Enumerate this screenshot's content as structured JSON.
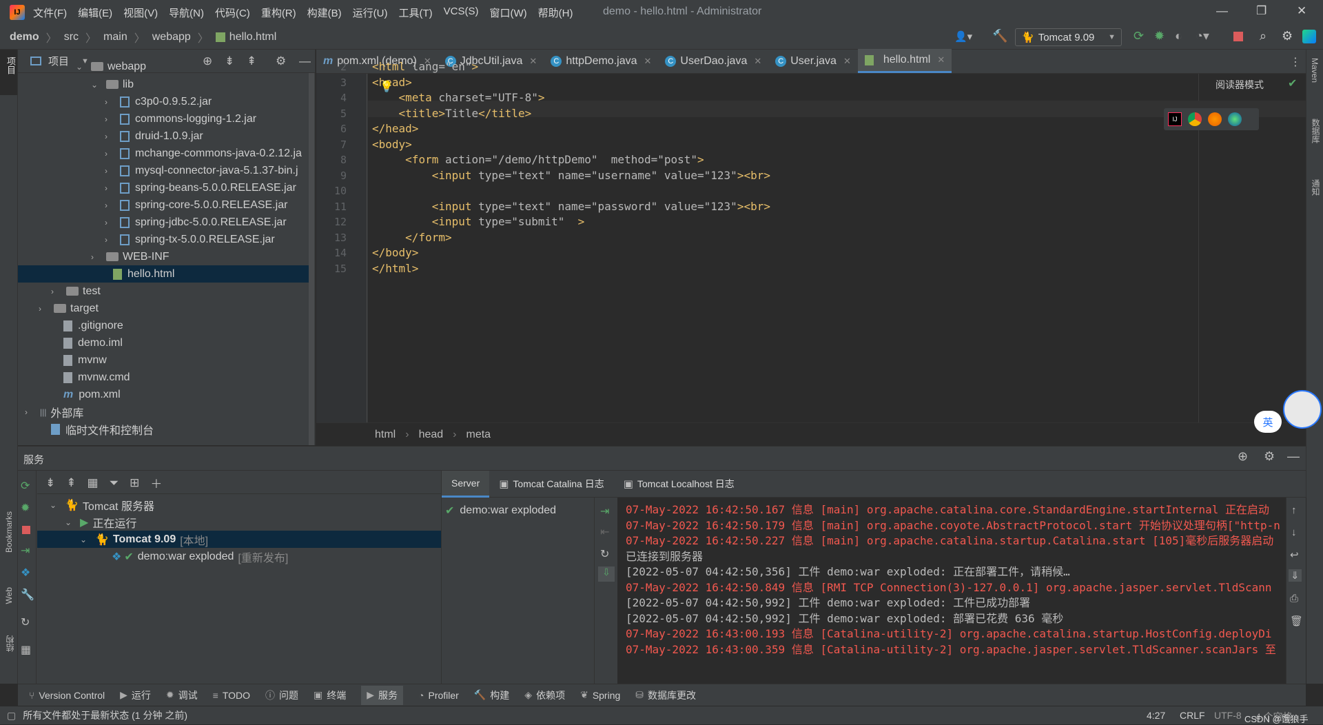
{
  "titlebar": {
    "menu": [
      "文件(F)",
      "编辑(E)",
      "视图(V)",
      "导航(N)",
      "代码(C)",
      "重构(R)",
      "构建(B)",
      "运行(U)",
      "工具(T)",
      "VCS(S)",
      "窗口(W)",
      "帮助(H)"
    ],
    "window_title": "demo - hello.html - Administrator"
  },
  "navbar": {
    "crumbs": [
      "demo",
      "src",
      "main",
      "webapp",
      "hello.html"
    ],
    "run_config": "Tomcat 9.09"
  },
  "project": {
    "title": "项目",
    "tree": [
      {
        "label": "webapp",
        "type": "folder"
      },
      {
        "label": "lib",
        "type": "folder"
      },
      {
        "label": "c3p0-0.9.5.2.jar",
        "type": "jar"
      },
      {
        "label": "commons-logging-1.2.jar",
        "type": "jar"
      },
      {
        "label": "druid-1.0.9.jar",
        "type": "jar"
      },
      {
        "label": "mchange-commons-java-0.2.12.ja",
        "type": "jar"
      },
      {
        "label": "mysql-connector-java-5.1.37-bin.j",
        "type": "jar"
      },
      {
        "label": "spring-beans-5.0.0.RELEASE.jar",
        "type": "jar"
      },
      {
        "label": "spring-core-5.0.0.RELEASE.jar",
        "type": "jar"
      },
      {
        "label": "spring-jdbc-5.0.0.RELEASE.jar",
        "type": "jar"
      },
      {
        "label": "spring-tx-5.0.0.RELEASE.jar",
        "type": "jar"
      },
      {
        "label": "WEB-INF",
        "type": "folder"
      },
      {
        "label": "hello.html",
        "type": "html"
      },
      {
        "label": "test",
        "type": "folder"
      },
      {
        "label": "target",
        "type": "folder"
      },
      {
        "label": ".gitignore",
        "type": "file"
      },
      {
        "label": "demo.iml",
        "type": "file"
      },
      {
        "label": "mvnw",
        "type": "file"
      },
      {
        "label": "mvnw.cmd",
        "type": "file"
      },
      {
        "label": "pom.xml",
        "type": "maven"
      },
      {
        "label": "外部库",
        "type": "lib"
      },
      {
        "label": "临时文件和控制台",
        "type": "scratch"
      }
    ]
  },
  "tabs": [
    {
      "label": "pom.xml (demo)"
    },
    {
      "label": "JdbcUtil.java"
    },
    {
      "label": "httpDemo.java"
    },
    {
      "label": "UserDao.java"
    },
    {
      "label": "User.java"
    },
    {
      "label": "hello.html"
    }
  ],
  "editor": {
    "reader_mode": "阅读器模式",
    "lines": [
      {
        "n": "2",
        "text": "<html lang=\"en\">"
      },
      {
        "n": "3",
        "text": "<head>"
      },
      {
        "n": "4",
        "text": "    <meta charset=\"UTF-8\">"
      },
      {
        "n": "5",
        "text": "    <title>Title</title>"
      },
      {
        "n": "6",
        "text": "</head>"
      },
      {
        "n": "7",
        "text": "<body>"
      },
      {
        "n": "8",
        "text": "     <form action=\"/demo/httpDemo\"  method=\"post\">"
      },
      {
        "n": "9",
        "text": "         <input type=\"text\" name=\"username\" value=\"123\"><br>"
      },
      {
        "n": "10",
        "text": ""
      },
      {
        "n": "11",
        "text": "         <input type=\"text\" name=\"password\" value=\"123\"><br>"
      },
      {
        "n": "12",
        "text": "         <input type=\"submit\"  >"
      },
      {
        "n": "13",
        "text": "     </form>"
      },
      {
        "n": "14",
        "text": "</body>"
      },
      {
        "n": "15",
        "text": "</html>"
      }
    ],
    "breadcrumbs": [
      "html",
      "head",
      "meta"
    ],
    "ime": "英"
  },
  "services": {
    "title": "服务",
    "tree": {
      "root": "Tomcat 服务器",
      "running": "正在运行",
      "server": "Tomcat 9.09",
      "server_tag": "[本地]",
      "artifact": "demo:war exploded",
      "artifact_tag": "[重新发布]"
    },
    "tabs": [
      "Server",
      "Tomcat Catalina 日志",
      "Tomcat Localhost 日志"
    ],
    "deploy_item": "demo:war exploded",
    "log": [
      {
        "style": "red",
        "text": "07-May-2022 16:42:50.167 信息 [main] org.apache.catalina.core.StandardEngine.startInternal 正在启动"
      },
      {
        "style": "red",
        "text": "07-May-2022 16:42:50.179 信息 [main] org.apache.coyote.AbstractProtocol.start 开始协议处理句柄[\"http-n"
      },
      {
        "style": "red",
        "text": "07-May-2022 16:42:50.227 信息 [main] org.apache.catalina.startup.Catalina.start [105]毫秒后服务器启动"
      },
      {
        "style": "gray",
        "text": "已连接到服务器"
      },
      {
        "style": "gray",
        "text": "[2022-05-07 04:42:50,356] 工件 demo:war exploded: 正在部署工件，请稍候…"
      },
      {
        "style": "red",
        "text": "07-May-2022 16:42:50.849 信息 [RMI TCP Connection(3)-127.0.0.1] org.apache.jasper.servlet.TldScann"
      },
      {
        "style": "gray",
        "text": "[2022-05-07 04:42:50,992] 工件 demo:war exploded: 工件已成功部署"
      },
      {
        "style": "gray",
        "text": "[2022-05-07 04:42:50,992] 工件 demo:war exploded: 部署已花费 636 毫秒"
      },
      {
        "style": "red",
        "text": "07-May-2022 16:43:00.193 信息 [Catalina-utility-2] org.apache.catalina.startup.HostConfig.deployDi"
      },
      {
        "style": "red",
        "text": "07-May-2022 16:43:00.359 信息 [Catalina-utility-2] org.apache.jasper.servlet.TldScanner.scanJars 至"
      }
    ]
  },
  "toolwindows": [
    "Version Control",
    "运行",
    "调试",
    "TODO",
    "问题",
    "终端",
    "服务",
    "Profiler",
    "构建",
    "依赖项",
    "Spring",
    "数据库更改"
  ],
  "status": {
    "message": "所有文件都处于最新状态 (1 分钟 之前)",
    "position": "4:27",
    "line_sep": "CRLF",
    "encoding": "UTF-8",
    "extra": "4 个空格",
    "watermark": "CSDN @饿狼手"
  },
  "side_labels": {
    "left": [
      "项目",
      "Bookmarks",
      "Web",
      "结构"
    ],
    "right": [
      "Maven",
      "数据库",
      "通知"
    ]
  },
  "colors": {
    "accent": "#4a88c7",
    "error": "#f2584f",
    "green": "#59a869"
  }
}
